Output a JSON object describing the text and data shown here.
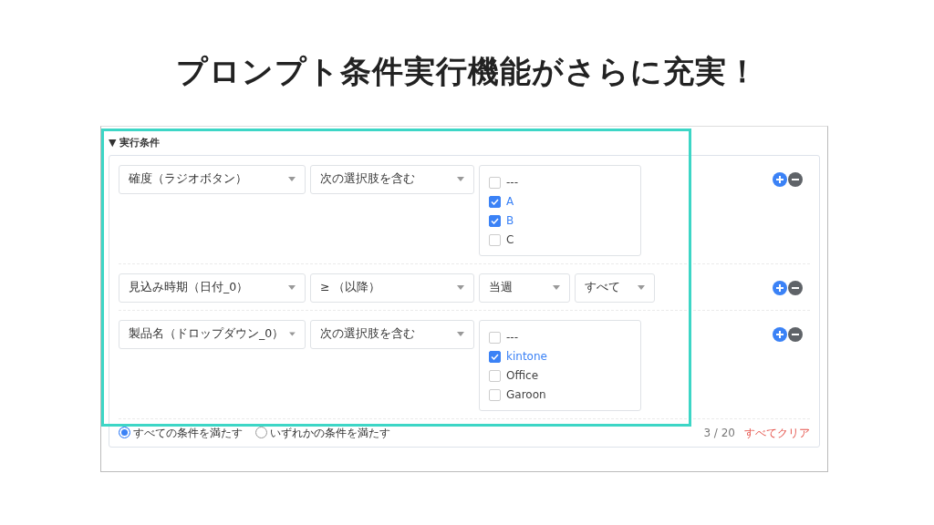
{
  "slide_title": "プロンプト条件実行機能がさらに充実！",
  "section": {
    "toggle": "▼",
    "title": "実行条件"
  },
  "conditions": [
    {
      "kind": "options",
      "field": "確度（ラジオボタン）",
      "operator": "次の選択肢を含む",
      "options": [
        {
          "label": "---",
          "checked": false
        },
        {
          "label": "A",
          "checked": true
        },
        {
          "label": "B",
          "checked": true
        },
        {
          "label": "C",
          "checked": false
        }
      ]
    },
    {
      "kind": "date",
      "field": "見込み時期（日付_0）",
      "operator": "≥ （以降）",
      "period": "当週",
      "range": "すべて"
    },
    {
      "kind": "options",
      "field": "製品名（ドロップダウン_0）",
      "operator": "次の選択肢を含む",
      "options": [
        {
          "label": "---",
          "checked": false
        },
        {
          "label": "kintone",
          "checked": true
        },
        {
          "label": "Office",
          "checked": false
        },
        {
          "label": "Garoon",
          "checked": false
        }
      ]
    }
  ],
  "match_modes": [
    {
      "label": "すべての条件を満たす",
      "selected": true
    },
    {
      "label": "いずれかの条件を満たす",
      "selected": false
    }
  ],
  "count": "3 / 20",
  "clear_link": "すべてクリア"
}
